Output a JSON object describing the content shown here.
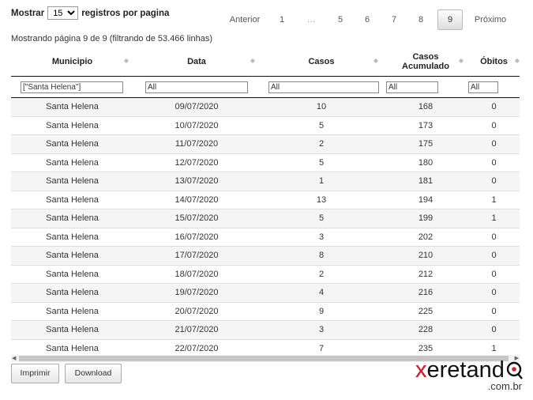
{
  "length_menu": {
    "prefix": "Mostrar",
    "selected": "15",
    "suffix": "registros por pagina"
  },
  "pagination": {
    "previous": "Anterior",
    "pages": [
      "1",
      "…",
      "5",
      "6",
      "7",
      "8"
    ],
    "current": "9",
    "next": "Próximo"
  },
  "info": "Mostrando página 9 de 9 (filtrando de 53.466 linhas)",
  "columns": {
    "municipio": "Municipio",
    "data": "Data",
    "casos": "Casos",
    "acumulado": "Casos Acumulado",
    "obitos": "Óbitos"
  },
  "filters": {
    "municipio": "[\"Santa Helena\"]",
    "data": "All",
    "casos": "All",
    "acumulado": "All",
    "obitos": "All"
  },
  "rows": [
    [
      "Santa Helena",
      "09/07/2020",
      "10",
      "168",
      "0"
    ],
    [
      "Santa Helena",
      "10/07/2020",
      "5",
      "173",
      "0"
    ],
    [
      "Santa Helena",
      "11/07/2020",
      "2",
      "175",
      "0"
    ],
    [
      "Santa Helena",
      "12/07/2020",
      "5",
      "180",
      "0"
    ],
    [
      "Santa Helena",
      "13/07/2020",
      "1",
      "181",
      "0"
    ],
    [
      "Santa Helena",
      "14/07/2020",
      "13",
      "194",
      "1"
    ],
    [
      "Santa Helena",
      "15/07/2020",
      "5",
      "199",
      "1"
    ],
    [
      "Santa Helena",
      "16/07/2020",
      "3",
      "202",
      "0"
    ],
    [
      "Santa Helena",
      "17/07/2020",
      "8",
      "210",
      "0"
    ],
    [
      "Santa Helena",
      "18/07/2020",
      "2",
      "212",
      "0"
    ],
    [
      "Santa Helena",
      "19/07/2020",
      "4",
      "216",
      "0"
    ],
    [
      "Santa Helena",
      "20/07/2020",
      "9",
      "225",
      "0"
    ],
    [
      "Santa Helena",
      "21/07/2020",
      "3",
      "228",
      "0"
    ],
    [
      "Santa Helena",
      "22/07/2020",
      "7",
      "235",
      "1"
    ]
  ],
  "buttons": {
    "print": "Imprimir",
    "download": "Download"
  },
  "logo": {
    "name": "xeretando",
    "domain": ".com.br",
    "accent": "#d6202a"
  }
}
